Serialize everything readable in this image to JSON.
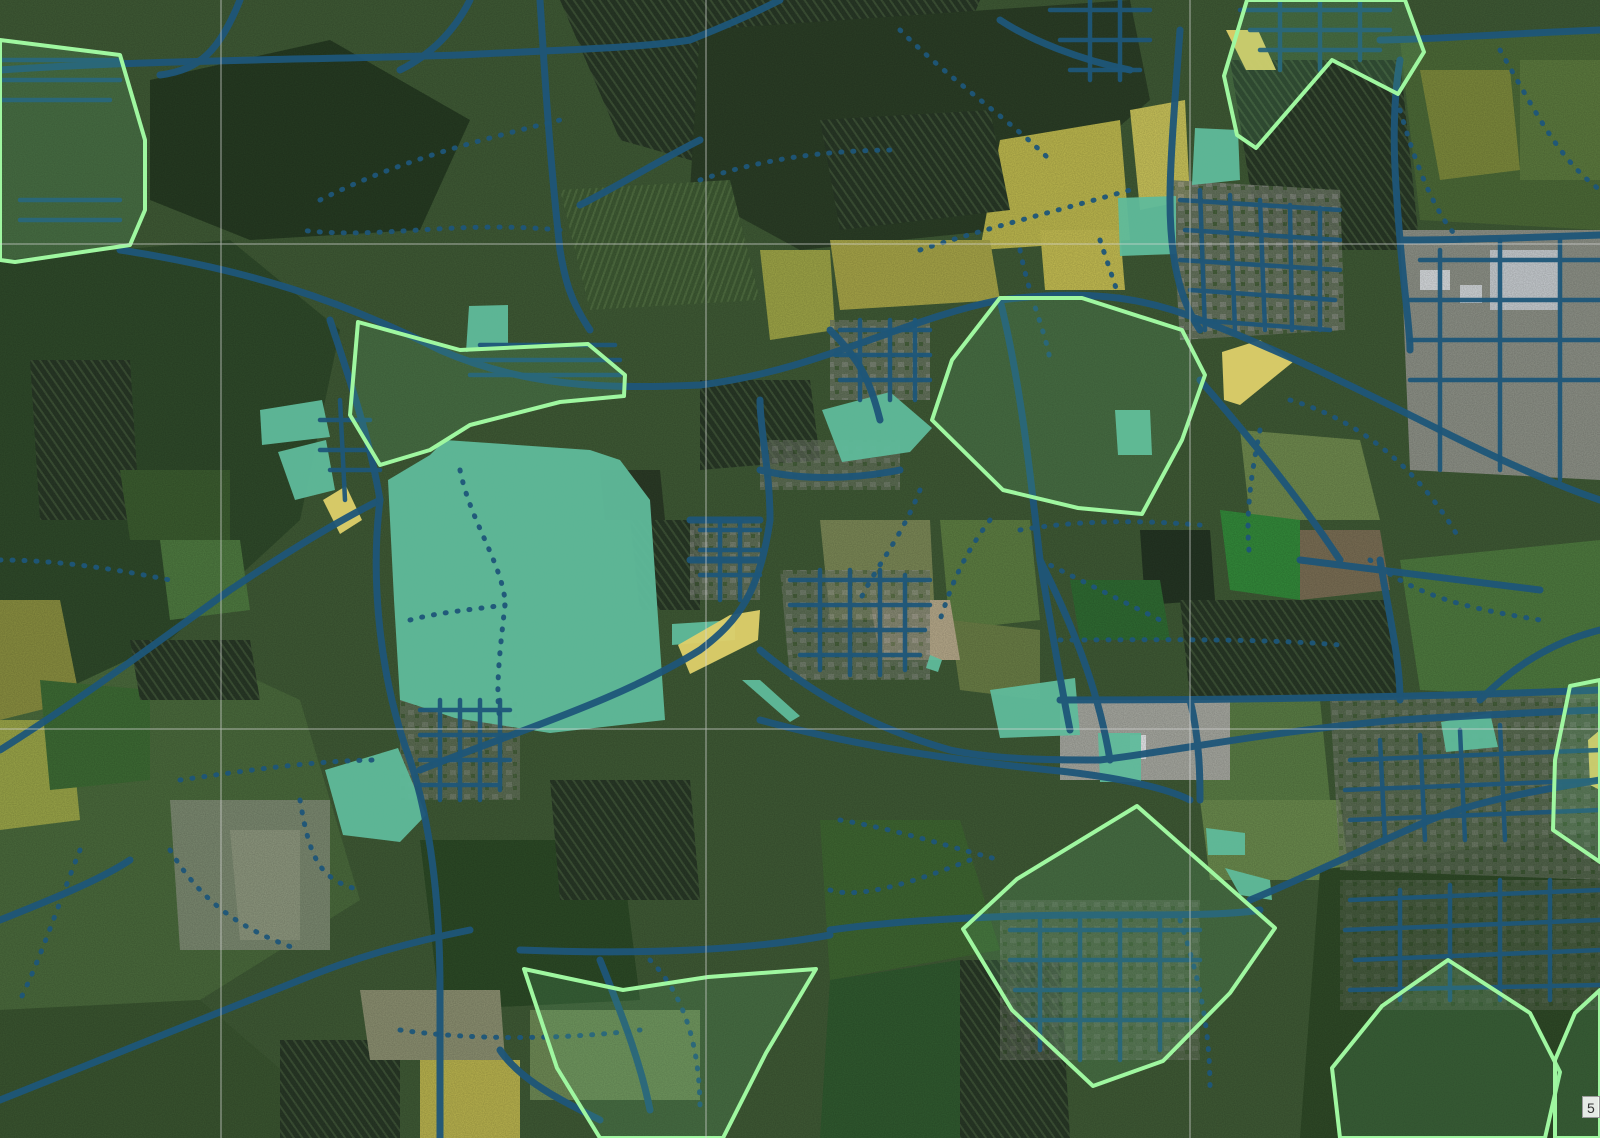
{
  "map": {
    "scale_label": "5",
    "basemap": "satellite-imagery",
    "colors": {
      "road": "#1e5679",
      "service_area_outline": "#9ff7a0",
      "teal_zone": "#5fba9b",
      "yellow_zone": "#ded06a",
      "grid_line": "#d9d9d9"
    },
    "layers": [
      {
        "name": "satellite-basemap"
      },
      {
        "name": "road-network"
      },
      {
        "name": "footpaths-dotted"
      },
      {
        "name": "teal-zones"
      },
      {
        "name": "yellow-zones"
      },
      {
        "name": "service-area-polygons"
      },
      {
        "name": "reference-grid"
      }
    ]
  }
}
